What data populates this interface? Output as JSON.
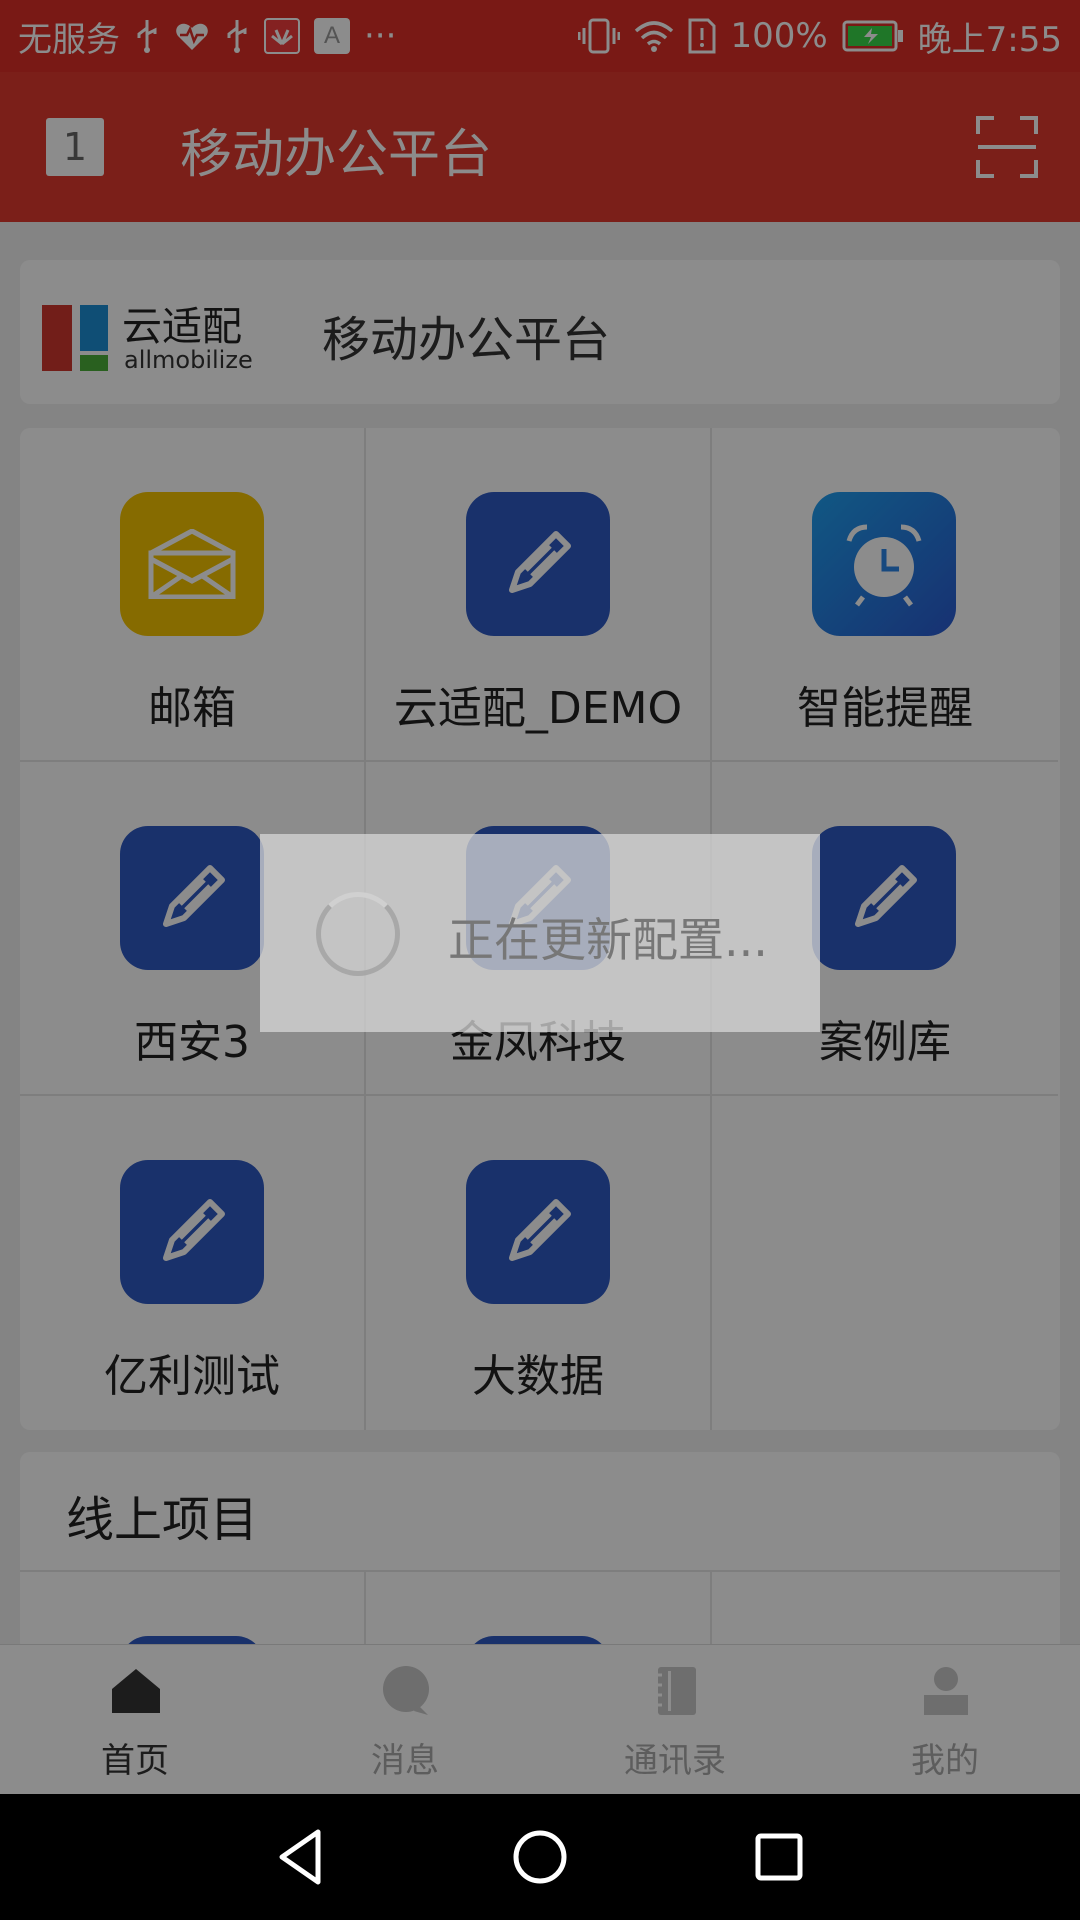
{
  "status_bar": {
    "carrier": "无服务",
    "battery": "100%",
    "time": "晚上7:55",
    "letter_icon": "A",
    "more": "···",
    "icons": [
      "usb-icon",
      "heartbeat-icon",
      "usb-icon",
      "huawei-icon",
      "app-a-icon",
      "vibrate-icon",
      "wifi-icon",
      "sim-alert-icon",
      "battery-icon"
    ]
  },
  "app_bar": {
    "badge": "1",
    "title": "移动办公平台",
    "scan_icon": "scan-icon"
  },
  "brand": {
    "name": "云适配",
    "subtitle": "allmobilize",
    "title": "移动办公平台"
  },
  "apps": [
    {
      "label": "邮箱",
      "icon": "mail-icon",
      "color": "#f5c400"
    },
    {
      "label": "云适配_DEMO",
      "icon": "pencil-icon",
      "color": "#2f5ac4"
    },
    {
      "label": "智能提醒",
      "icon": "alarm-clock-icon",
      "color": "#2a86e8"
    },
    {
      "label": "西安3",
      "icon": "pencil-icon",
      "color": "#2f5ac4"
    },
    {
      "label": "金凤科技",
      "icon": "pencil-icon",
      "color": "#2f5ac4"
    },
    {
      "label": "案例库",
      "icon": "pencil-icon",
      "color": "#2f5ac4"
    },
    {
      "label": "亿利测试",
      "icon": "pencil-icon",
      "color": "#2f5ac4"
    },
    {
      "label": "大数据",
      "icon": "pencil-icon",
      "color": "#2f5ac4"
    }
  ],
  "online": {
    "title": "线上项目"
  },
  "bottom_nav": [
    {
      "label": "首页",
      "icon": "home-icon",
      "active": true
    },
    {
      "label": "消息",
      "icon": "message-icon",
      "active": false
    },
    {
      "label": "通讯录",
      "icon": "contacts-icon",
      "active": false
    },
    {
      "label": "我的",
      "icon": "profile-icon",
      "active": false
    }
  ],
  "dialog": {
    "text": "正在更新配置..."
  },
  "colors": {
    "brand_red": "#e03a2f",
    "status_red": "#dc2f27",
    "app_blue": "#2f5ac4",
    "mail_yellow": "#f5c400",
    "alarm_blue": "#2a86e8"
  }
}
